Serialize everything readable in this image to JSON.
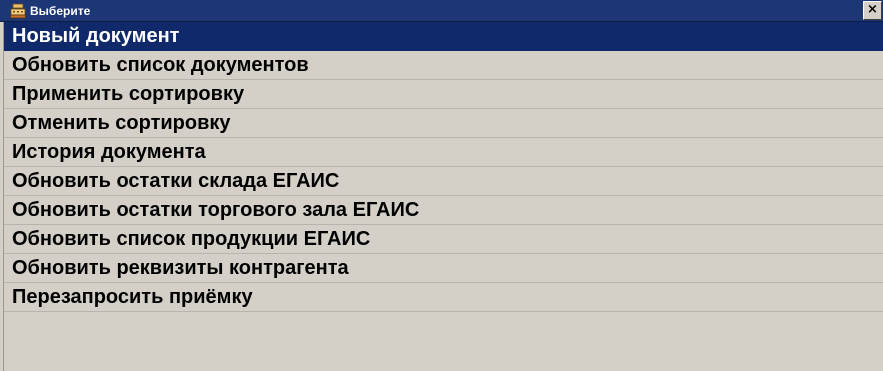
{
  "window": {
    "title": "Выберите",
    "icon": "cash-register-icon",
    "close_label": "×"
  },
  "menu": {
    "selected_index": 0,
    "items": [
      {
        "label": "Новый документ"
      },
      {
        "label": "Обновить список документов"
      },
      {
        "label": "Применить сортировку"
      },
      {
        "label": "Отменить сортировку"
      },
      {
        "label": "История документа"
      },
      {
        "label": "Обновить остатки склада ЕГАИС"
      },
      {
        "label": "Обновить остатки торгового зала ЕГАИС"
      },
      {
        "label": "Обновить список продукции ЕГАИС"
      },
      {
        "label": "Обновить реквизиты контрагента"
      },
      {
        "label": "Перезапросить приёмку"
      }
    ]
  },
  "colors": {
    "titlebar": "#1c3676",
    "selection": "#10296b",
    "background": "#d4d0c8"
  }
}
